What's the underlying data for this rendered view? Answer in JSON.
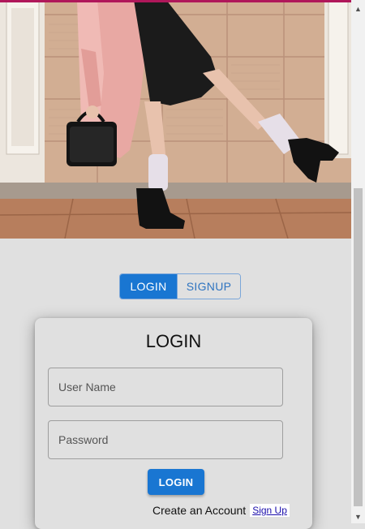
{
  "hero": {
    "image_description_icon": "fashion-photo-icon"
  },
  "toggle": {
    "login_label": "LOGIN",
    "signup_label": "SIGNUP"
  },
  "card": {
    "title": "LOGIN",
    "username_placeholder": "User Name",
    "password_placeholder": "Password",
    "submit_label": "LOGIN",
    "create_account_text": "Create an Account",
    "signup_link": "Sign Up"
  },
  "scrollbar": {
    "up_icon": "▲",
    "down_icon": "▼"
  },
  "colors": {
    "primary": "#1976d2",
    "background": "#e0e0e0",
    "accent": "#b0175a"
  }
}
